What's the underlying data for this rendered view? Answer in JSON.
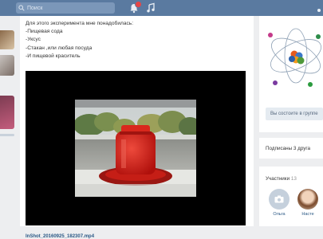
{
  "header": {
    "search_placeholder": "Поиск"
  },
  "post": {
    "lines": [
      "Для этого эксперимента мне понадобилась:",
      "-Пищевая сода",
      "-Уксус",
      "-Стакан ,или любая посуда",
      "-И пищевой краситель"
    ],
    "video_filename": "InShot_20160925_182307.mp4"
  },
  "sidebar_right": {
    "join_button": "Вы состоите в группе",
    "subscriptions": "Подписаны 3 друга",
    "members_label": "Участники",
    "members_count": "13",
    "members": [
      {
        "name": "Ольга"
      },
      {
        "name": "Насте"
      }
    ]
  },
  "colors": {
    "header": "#5a7aa0",
    "page_bg": "#edeef0",
    "link": "#2a5885"
  }
}
